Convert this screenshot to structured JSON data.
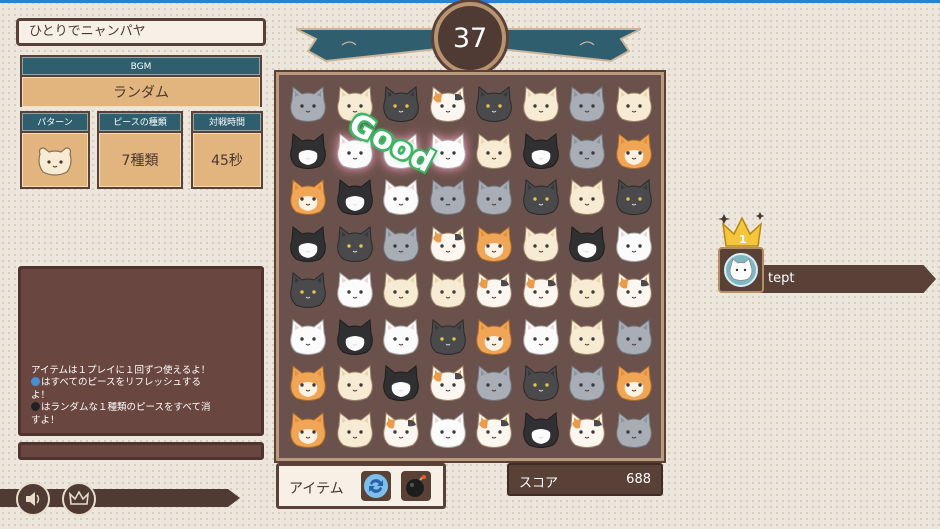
{
  "header": {
    "title": "ひとりでニャンパヤ"
  },
  "settings": {
    "bgm_label": "BGM",
    "bgm_value": "ランダム",
    "pattern_label": "パターン",
    "piece_label": "ピースの種類",
    "piece_value": "7種類",
    "time_label": "対戦時間",
    "time_value": "45秒"
  },
  "info": {
    "lines": [
      "アイテムは１プレイに１回ずつ使えるよ！",
      "はすべてのピースをリフレッシュする",
      "よ！",
      "はランダムな１種類のピースをすべて消",
      "すよ！"
    ]
  },
  "timer": {
    "value": "37"
  },
  "effect": {
    "text": "Good"
  },
  "items": {
    "label": "アイテム",
    "refresh_icon": "refresh-icon",
    "bomb_icon": "bomb-icon"
  },
  "score": {
    "label": "スコア",
    "value": "688"
  },
  "player": {
    "rank": "1",
    "name": "tept"
  },
  "board": {
    "rows": [
      [
        "gray",
        "cream",
        "black",
        "calico",
        "black",
        "cream",
        "gray",
        "cream"
      ],
      [
        "tux",
        "white",
        "white",
        "white",
        "cream",
        "tux",
        "gray",
        "orange"
      ],
      [
        "orange",
        "tux",
        "white",
        "gray",
        "gray",
        "black",
        "cream",
        "black"
      ],
      [
        "tux",
        "black",
        "gray",
        "calico",
        "orange",
        "cream",
        "tux",
        "white"
      ],
      [
        "black",
        "white",
        "cream",
        "cream",
        "calico",
        "calico",
        "cream",
        "calico"
      ],
      [
        "white",
        "tux",
        "white",
        "black",
        "orange",
        "white",
        "cream",
        "gray"
      ],
      [
        "orange",
        "cream",
        "tux",
        "calico",
        "gray",
        "black",
        "gray",
        "orange"
      ],
      [
        "orange",
        "cream",
        "calico",
        "white",
        "calico",
        "tux",
        "calico",
        "gray"
      ]
    ]
  },
  "colors": {
    "accent_teal": "#2f5f6f",
    "panel_brown": "#5a4138",
    "tab_orange": "#e2b57f",
    "good_green": "#3eb464"
  }
}
